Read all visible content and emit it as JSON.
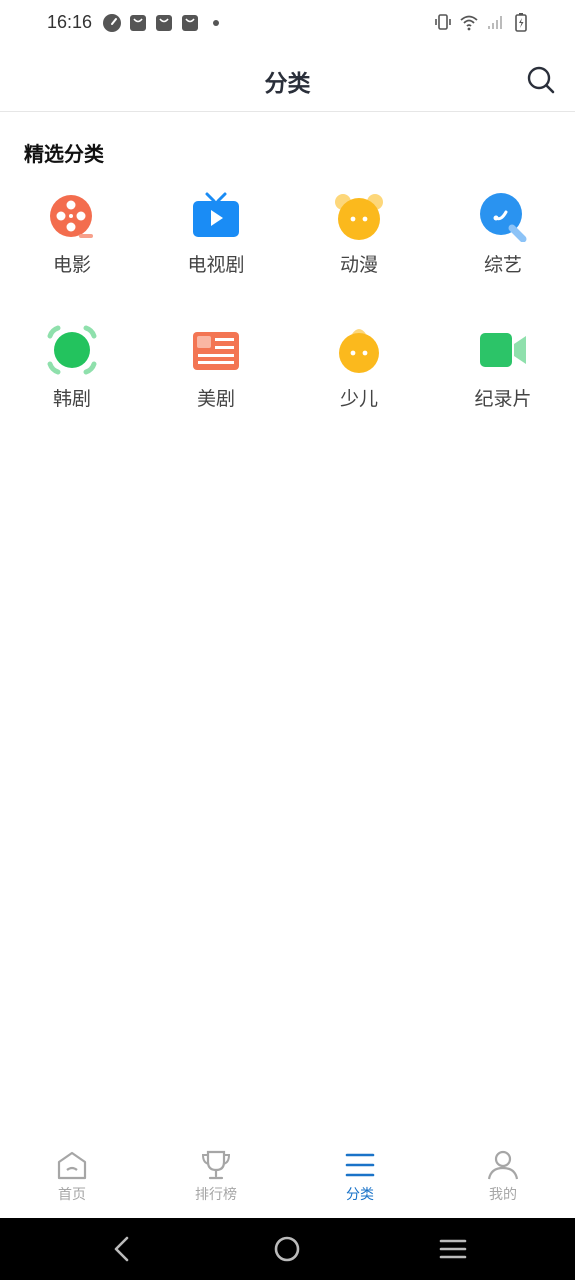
{
  "status_bar": {
    "time": "16:16",
    "left_icons": [
      "speedometer-icon",
      "bag-icon",
      "bag-icon",
      "bag-icon",
      "dot-icon"
    ],
    "right_icons": [
      "vibrate-icon",
      "wifi-icon",
      "signal-icon",
      "battery-charging-icon"
    ]
  },
  "header": {
    "title": "分类",
    "search_icon": "search-icon"
  },
  "section": {
    "title": "精选分类"
  },
  "categories": [
    {
      "label": "电影",
      "icon": "film-reel-icon",
      "color": "#f36d4e"
    },
    {
      "label": "电视剧",
      "icon": "tv-icon",
      "color": "#1a8cf5"
    },
    {
      "label": "动漫",
      "icon": "cartoon-bear-icon",
      "color": "#fbb91d"
    },
    {
      "label": "综艺",
      "icon": "microphone-icon",
      "color": "#2a93f0"
    },
    {
      "label": "韩剧",
      "icon": "green-circle-icon",
      "color": "#23c35e"
    },
    {
      "label": "美剧",
      "icon": "newspaper-icon",
      "color": "#f37553"
    },
    {
      "label": "少儿",
      "icon": "kid-face-icon",
      "color": "#fbb91d"
    },
    {
      "label": "纪录片",
      "icon": "video-camera-icon",
      "color": "#2cc468"
    }
  ],
  "bottom_nav": {
    "items": [
      {
        "label": "首页",
        "icon": "home-icon",
        "active": false
      },
      {
        "label": "排行榜",
        "icon": "trophy-icon",
        "active": false
      },
      {
        "label": "分类",
        "icon": "list-icon",
        "active": true
      },
      {
        "label": "我的",
        "icon": "person-icon",
        "active": false
      }
    ],
    "active_color": "#1a73c8",
    "inactive_color": "#a6a6a6"
  },
  "system_nav": {
    "buttons": [
      "back-icon",
      "home-circle-icon",
      "menu-icon"
    ]
  }
}
